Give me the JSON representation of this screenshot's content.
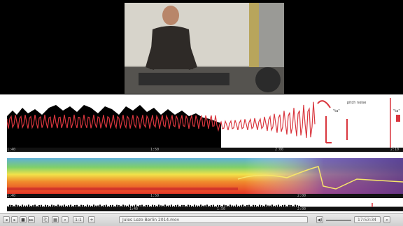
{
  "video": {
    "description_hidden": ""
  },
  "waveform": {
    "annotation": "pitch noise",
    "marker_labels": [
      "\"ta\"",
      "\"ta\""
    ]
  },
  "timeline1": {
    "labels": [
      "1:40",
      "1:50",
      "2:00",
      "2:10"
    ]
  },
  "timeline2": {
    "labels": [
      "1:40",
      "1:50",
      "2:00"
    ]
  },
  "timeline3": {
    "labels": [
      "1:40",
      "1:50",
      "2:00"
    ]
  },
  "toolbar": {
    "buttons": [
      "◂",
      "▸",
      "■",
      "▸▸",
      "⎘",
      "▦",
      "⌕",
      "1:1",
      "+"
    ],
    "filename": "Jules Lezo Berlin 2014.mov",
    "timecode": "17:53:34",
    "volume_icon": "◀)",
    "zoom_icon": "⌕"
  },
  "colors": {
    "waveform_fill": "#000000",
    "pitch_line": "#d9363e",
    "sonogram_high": "#e53228",
    "sonogram_low": "#6a3fa0"
  }
}
